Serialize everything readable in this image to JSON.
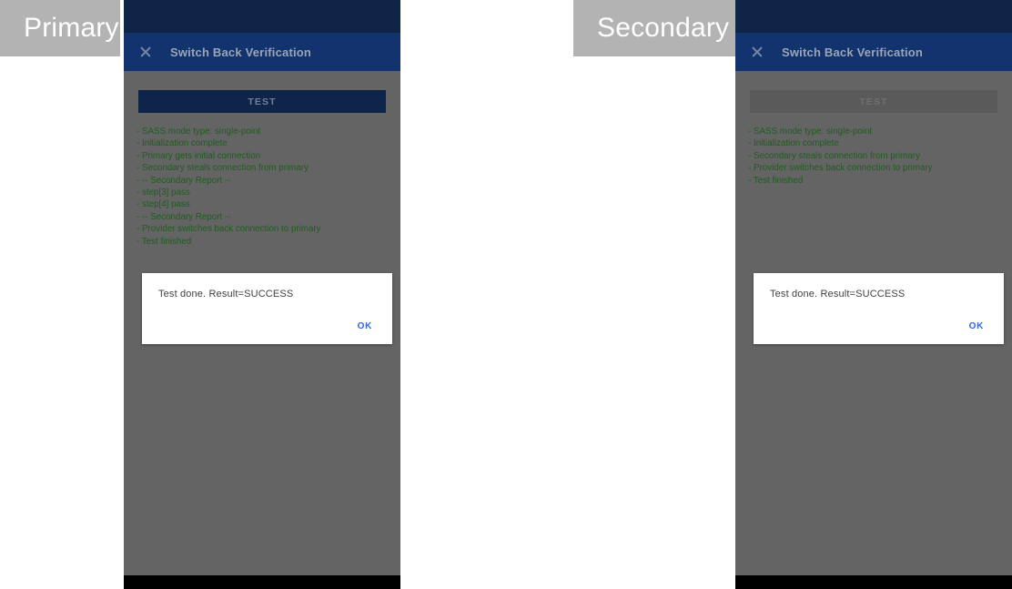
{
  "panels": [
    {
      "caption": "Primary",
      "app_bar": {
        "title": "Switch Back Verification",
        "close_icon": "close-icon"
      },
      "test_button": {
        "label": "TEST",
        "enabled": true
      },
      "log_lines": [
        "- SASS mode type: single-point",
        "- Initialization complete",
        "- Primary gets initial connection",
        "- Secondary steals connection from primary",
        "- -- Secondary Report --",
        "- step[3] pass",
        "- step[4] pass",
        "- -- Secondary Report --",
        "- Provider switches back connection to primary",
        "- Test finished"
      ],
      "dialog": {
        "message": "Test done. Result=SUCCESS",
        "ok_label": "OK"
      }
    },
    {
      "caption": "Secondary",
      "app_bar": {
        "title": "Switch Back Verification",
        "close_icon": "close-icon"
      },
      "test_button": {
        "label": "TEST",
        "enabled": false
      },
      "log_lines": [
        "- SASS mode type: single-point",
        "- Initialization complete",
        "- Secondary steals connection from primary",
        "- Provider switches back connection to primary",
        "- Test finished"
      ],
      "dialog": {
        "message": "Test done. Result=SUCCESS",
        "ok_label": "OK"
      }
    }
  ],
  "colors": {
    "caption_band": "#b3b3b3",
    "status_bar": "#0f2346",
    "app_bar": "#12336d",
    "app_bar_text": "#9aa5b8",
    "panel_background": "#646464",
    "test_button_enabled": "#0e2449",
    "test_button_disabled": "#5a5a5a",
    "log_text": "#1f5c21",
    "dialog_background": "#ffffff",
    "dialog_action_text": "#3367d6",
    "nav_bar": "#000000"
  }
}
